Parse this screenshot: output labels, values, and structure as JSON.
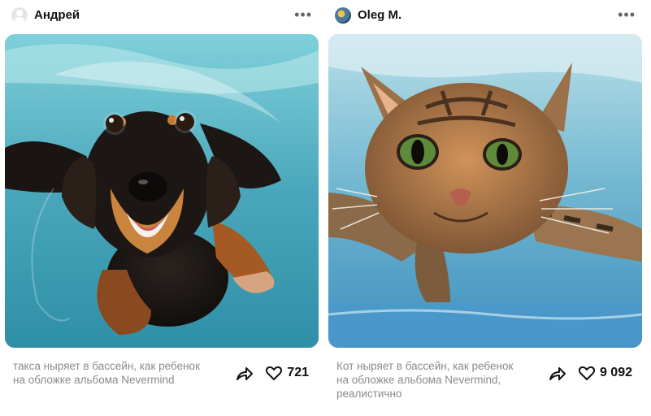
{
  "posts": [
    {
      "author": "Андрей",
      "more_glyph": "•••",
      "image_desc": "dachshund-swimming-underwater",
      "caption": "такса ныряет в бассейн, как ребенок на обложке альбома Nevermind",
      "likes": "721",
      "icons": [
        "share-icon",
        "heart-icon",
        "more-icon",
        "avatar-placeholder-icon"
      ]
    },
    {
      "author": "Oleg M.",
      "more_glyph": "•••",
      "image_desc": "tabby-cat-swimming-underwater",
      "caption": "Кот ныряет в бассейн, как ребенок на обложке альбома Nevermind, реалистично",
      "likes": "9 092",
      "icons": [
        "share-icon",
        "heart-icon",
        "more-icon"
      ]
    }
  ],
  "colors": {
    "caption": "#8a8a8a",
    "water": "#5fb7c9",
    "text": "#111111"
  }
}
